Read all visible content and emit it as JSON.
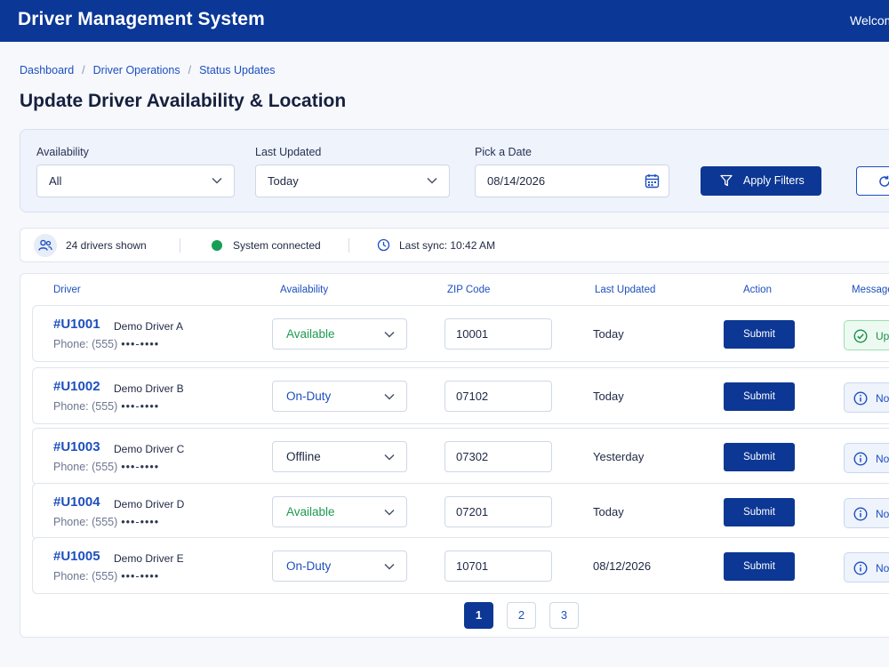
{
  "header": {
    "app_title": "Driver Management System",
    "welcome_text": "Welcom"
  },
  "breadcrumb": [
    "Dashboard",
    "Driver Operations",
    "Status Updates"
  ],
  "page_title": "Update Driver Availability & Location",
  "filters": {
    "availability_label": "Availability",
    "availability_value": "All",
    "last_updated_label": "Last Updated",
    "last_updated_value": "Today",
    "date_label": "Pick a Date",
    "date_value": "08/14/2026",
    "apply_label": "Apply Filters"
  },
  "status": {
    "drivers_shown": "24 drivers shown",
    "connection": "System connected",
    "last_sync": "Last sync: 10:42 AM"
  },
  "table": {
    "headers": [
      "Driver",
      "Availability",
      "ZIP Code",
      "Last Updated",
      "Action",
      "Message"
    ],
    "rows": [
      {
        "id": "#U1001",
        "name": "Demo Driver A",
        "phone": "Phone: (555)",
        "phone_mask": "•••-••••",
        "availability": "Available",
        "zip": "10001",
        "last_updated": "Today",
        "action": "Submit",
        "message": "Up",
        "message_type": "success"
      },
      {
        "id": "#U1002",
        "name": "Demo Driver B",
        "phone": "Phone: (555)",
        "phone_mask": "•••-••••",
        "availability": "On-Duty",
        "zip": "07102",
        "last_updated": "Today",
        "action": "Submit",
        "message": "No",
        "message_type": "info"
      },
      {
        "id": "#U1003",
        "name": "Demo Driver C",
        "phone": "Phone: (555)",
        "phone_mask": "•••-••••",
        "availability": "Offline",
        "zip": "07302",
        "last_updated": "Yesterday",
        "action": "Submit",
        "message": "No",
        "message_type": "info"
      },
      {
        "id": "#U1004",
        "name": "Demo Driver D",
        "phone": "Phone: (555)",
        "phone_mask": "•••-••••",
        "availability": "Available",
        "zip": "07201",
        "last_updated": "Today",
        "action": "Submit",
        "message": "No",
        "message_type": "info"
      },
      {
        "id": "#U1005",
        "name": "Demo Driver E",
        "phone": "Phone: (555)",
        "phone_mask": "•••-••••",
        "availability": "On-Duty",
        "zip": "10701",
        "last_updated": "08/12/2026",
        "action": "Submit",
        "message": "No",
        "message_type": "info"
      }
    ]
  },
  "pagination": {
    "pages": [
      "1",
      "2",
      "3"
    ],
    "current": "1"
  },
  "colors": {
    "brand": "#0b3797",
    "available": "#1d9a50",
    "on_duty": "#1d4fbf",
    "offline": "#1e2744",
    "connected": "#179e56"
  },
  "icons": {
    "date": "calendar-icon",
    "apply": "filter-icon",
    "reset": "refresh-icon",
    "drivers": "users-icon",
    "sync": "clock-icon",
    "success": "check-circle-icon",
    "info": "info-circle-icon"
  }
}
